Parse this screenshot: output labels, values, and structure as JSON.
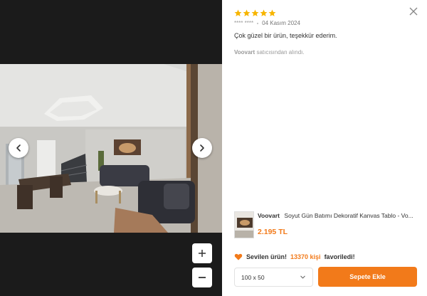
{
  "review": {
    "rating": 5,
    "user": "**** ****",
    "date": "04 Kasım 2024",
    "comment": "Çok güzel bir ürün, teşekkür ederim.",
    "seller_name": "Voovart",
    "seller_suffix": "satıcısından alındı."
  },
  "product": {
    "brand": "Voovart",
    "name": "Soyut Gün Batımı Dekoratif Kanvas Tablo - Vo...",
    "price": "2.195 TL"
  },
  "favorite": {
    "prefix": "Sevilen ürün!",
    "count": "13370 kişi",
    "suffix": "favoriledi!"
  },
  "size_select": {
    "value": "100 x 50"
  },
  "cart_button": {
    "label": "Sepete Ekle"
  },
  "colors": {
    "accent": "#f27a1a",
    "star": "#f7b500",
    "viewer_bg": "#1b1b1b"
  },
  "icons": [
    "star-icon",
    "close-icon",
    "chevron-left-icon",
    "chevron-right-icon",
    "plus-icon",
    "minus-icon",
    "heart-icon",
    "chevron-down-icon"
  ]
}
